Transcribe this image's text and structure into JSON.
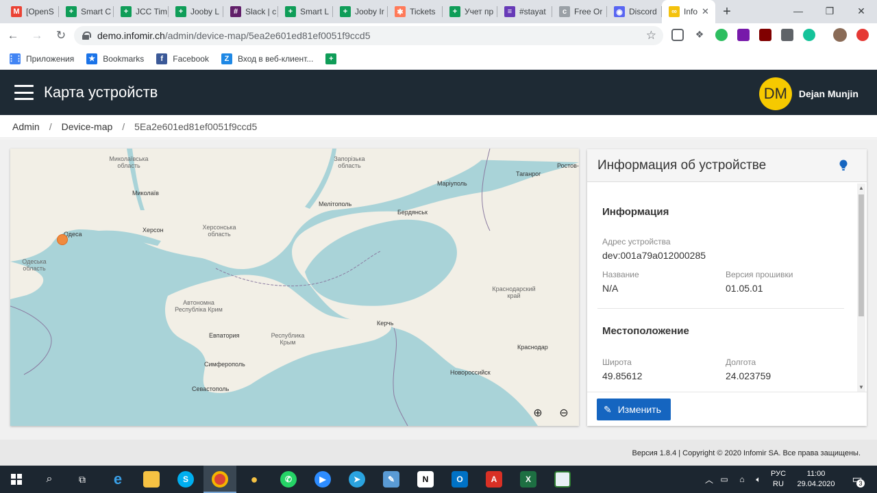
{
  "browser": {
    "tabs": [
      {
        "title": "[OpenS",
        "icon": "gmail-icon",
        "color": "#ea4335",
        "glyph": "M"
      },
      {
        "title": "Smart C",
        "icon": "sheets-icon",
        "color": "#0f9d58",
        "glyph": "+"
      },
      {
        "title": "JCC Tim",
        "icon": "sheets-icon",
        "color": "#0f9d58",
        "glyph": "+"
      },
      {
        "title": "Jooby L",
        "icon": "sheets-icon",
        "color": "#0f9d58",
        "glyph": "+"
      },
      {
        "title": "Slack | c",
        "icon": "slack-icon",
        "color": "#611f69",
        "glyph": "#"
      },
      {
        "title": "Smart L",
        "icon": "sheets-icon",
        "color": "#0f9d58",
        "glyph": "+"
      },
      {
        "title": "Jooby Ir",
        "icon": "sheets-icon",
        "color": "#0f9d58",
        "glyph": "+"
      },
      {
        "title": "Tickets",
        "icon": "hubspot-icon",
        "color": "#ff7a59",
        "glyph": "✱"
      },
      {
        "title": "Учет пр",
        "icon": "sheets-icon",
        "color": "#0f9d58",
        "glyph": "+"
      },
      {
        "title": "#stayat",
        "icon": "forms-icon",
        "color": "#673ab7",
        "glyph": "≡"
      },
      {
        "title": "Free Or",
        "icon": "page-icon",
        "color": "#9aa0a6",
        "glyph": "c"
      },
      {
        "title": "Discord",
        "icon": "discord-icon",
        "color": "#5865f2",
        "glyph": "◉"
      }
    ],
    "active_tab": {
      "title": "Info",
      "icon": "infomir-icon",
      "color": "#f4c20d",
      "close": "✕"
    },
    "new_tab": "+",
    "window_controls": {
      "minimize": "—",
      "restore": "❐",
      "close": "✕"
    },
    "url_host": "demo.infomir.ch",
    "url_path": "/admin/device-map/5ea2e601ed81ef0051f9ccd5",
    "bookmarks": [
      {
        "label": "Приложения",
        "icon": "apps-grid-icon",
        "color": "#4285f4",
        "glyph": "⋮⋮"
      },
      {
        "label": "Bookmarks",
        "icon": "star-icon",
        "color": "#1a73e8",
        "glyph": "★"
      },
      {
        "label": "Facebook",
        "icon": "facebook-icon",
        "color": "#3b5998",
        "glyph": "f"
      },
      {
        "label": "Вход в веб-клиент...",
        "icon": "zimbra-icon",
        "color": "#1e88e5",
        "glyph": "Z"
      },
      {
        "label": "",
        "icon": "sheets-icon",
        "color": "#0f9d58",
        "glyph": "+"
      }
    ]
  },
  "app": {
    "title": "Карта устройств",
    "user_initials": "DM",
    "user_name": "Dejan Munjin",
    "accent": "#f6c900",
    "header_bg": "#1e2a34"
  },
  "breadcrumb": {
    "items": [
      "Admin",
      "Device-map",
      "5Ea2e601ed81ef0051f9ccd5"
    ]
  },
  "map": {
    "labels": [
      {
        "text": "Миколаївська область",
        "kind": "region"
      },
      {
        "text": "Запорізька область",
        "kind": "region"
      },
      {
        "text": "Миколаїв",
        "kind": "city"
      },
      {
        "text": "Мелітополь",
        "kind": "city"
      },
      {
        "text": "Маріуполь",
        "kind": "city"
      },
      {
        "text": "Таганрог",
        "kind": "city"
      },
      {
        "text": "Ростов-на-Дону",
        "kind": "city"
      },
      {
        "text": "Бердянськ",
        "kind": "city"
      },
      {
        "text": "Херсон",
        "kind": "city"
      },
      {
        "text": "Херсонська область",
        "kind": "region"
      },
      {
        "text": "Одеса",
        "kind": "city"
      },
      {
        "text": "Одеська область",
        "kind": "region"
      },
      {
        "text": "Автономна Республіка Крим",
        "kind": "region"
      },
      {
        "text": "Краснодарский край",
        "kind": "region"
      },
      {
        "text": "Керчь",
        "kind": "city"
      },
      {
        "text": "Евпатория",
        "kind": "city"
      },
      {
        "text": "Республика Крым",
        "kind": "region"
      },
      {
        "text": "Краснодар",
        "kind": "city"
      },
      {
        "text": "Симферополь",
        "kind": "city"
      },
      {
        "text": "Новороссийск",
        "kind": "city"
      },
      {
        "text": "Севастополь",
        "kind": "city"
      }
    ],
    "zoom_in": "⊕",
    "zoom_out": "⊖",
    "land_color": "#f2efe6",
    "water_color": "#a9d3d8",
    "marker_color": "#f08a3e"
  },
  "panel": {
    "title": "Информация об устройстве",
    "section_info": "Информация",
    "device_address_label": "Адрес устройства",
    "device_address": "dev:001a79a012000285",
    "name_label": "Название",
    "name_value": "N/A",
    "firmware_label": "Версия прошивки",
    "firmware_value": "01.05.01",
    "section_location": "Местоположение",
    "lat_label": "Широта",
    "lat_value": "49.85612",
    "lon_label": "Долгота",
    "lon_value": "24.023759",
    "edit_button": "Изменить"
  },
  "footer": {
    "text": "Версия 1.8.4 | Copyright © 2020 Infomir SA. Все права защищены."
  },
  "taskbar": {
    "language": "РУС",
    "layout": "RU",
    "time": "11:00",
    "date": "29.04.2020",
    "notifications": "3"
  }
}
